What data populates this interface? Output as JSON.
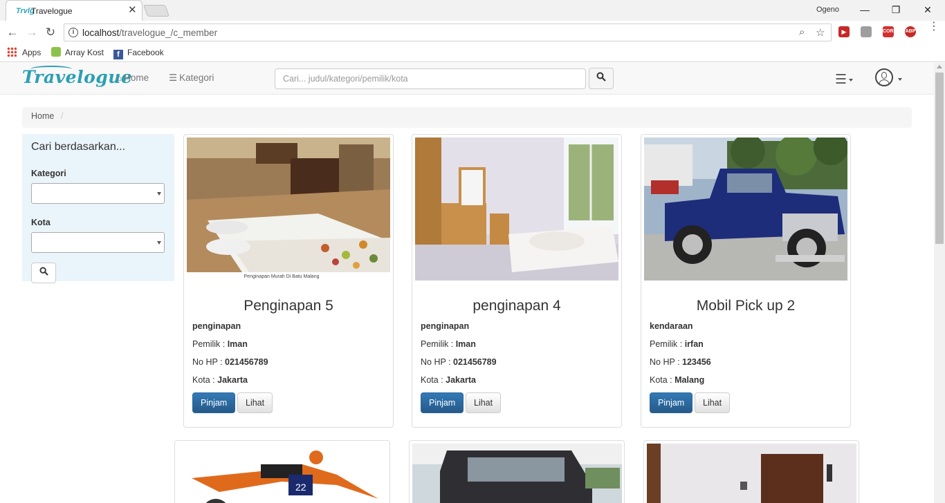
{
  "browser": {
    "tab_title": "Travelogue",
    "tab_favicon_text": "Trvlg",
    "user": "Ogeno",
    "url_host": "localhost",
    "url_path": "/travelogue_/c_member",
    "bookmarks": [
      "Apps",
      "Array Kost",
      "Facebook"
    ],
    "extensions": [
      "CORS",
      "ABP"
    ]
  },
  "navbar": {
    "brand": "Travelogue",
    "home_label": "Home",
    "kategori_label": "Kategori",
    "search_placeholder": "Cari... judul/kategori/pemilik/kota"
  },
  "breadcrumb": {
    "home": "Home",
    "separator": "/"
  },
  "sidebar": {
    "title": "Cari berdasarkan...",
    "kategori_label": "Kategori",
    "kota_label": "Kota"
  },
  "labels": {
    "pemilik": "Pemilik : ",
    "nohp": "No HP : ",
    "kota": "Kota : ",
    "pinjam": "Pinjam",
    "lihat": "Lihat"
  },
  "listings": [
    {
      "title": "Penginapan 5",
      "category": "penginapan",
      "owner": "Iman",
      "phone": "021456789",
      "city": "Jakarta",
      "image_caption": "Penginapan Murah Di Batu Malang"
    },
    {
      "title": "penginapan 4",
      "category": "penginapan",
      "owner": "Iman",
      "phone": "021456789",
      "city": "Jakarta"
    },
    {
      "title": "Mobil Pick up 2",
      "category": "kendaraan",
      "owner": "irfan",
      "phone": "123456",
      "city": "Malang"
    }
  ],
  "colors": {
    "brand": "#2b9fb3",
    "primary_button": "#2d6ca2",
    "sidebar_bg": "#eaf4fb"
  }
}
